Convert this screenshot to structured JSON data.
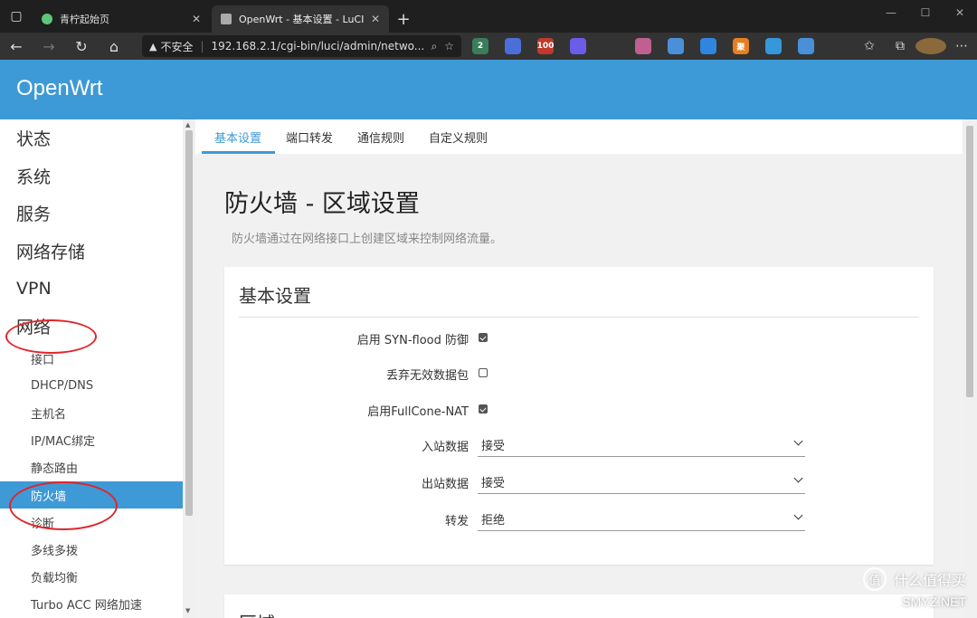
{
  "browser": {
    "tabs": [
      {
        "title": "青柠起始页",
        "active": false,
        "favicon_color": "#5cc77a"
      },
      {
        "title": "OpenWrt - 基本设置 - LuCI",
        "active": true,
        "favicon_color": "#aaaaaa"
      }
    ],
    "security_label": "不安全",
    "url": "192.168.2.1/cgi-bin/luci/admin/netwo...",
    "extensions": [
      {
        "name": "ext-a",
        "badge": "2",
        "color": "#3a7d5a"
      },
      {
        "name": "ext-b",
        "badge": "",
        "color": "#4b6fd8"
      },
      {
        "name": "ext-zh",
        "badge": "100",
        "color": "#c0392b"
      },
      {
        "name": "ext-d",
        "badge": "",
        "color": "#6c5ce7"
      },
      {
        "name": "ext-e",
        "badge": "",
        "color": "#333333"
      },
      {
        "name": "ext-cat",
        "badge": "",
        "color": "#c06090"
      },
      {
        "name": "ext-g",
        "badge": "",
        "color": "#4a90d9"
      },
      {
        "name": "ext-h",
        "badge": "",
        "color": "#2e86de"
      },
      {
        "name": "ext-ju",
        "badge": "聚",
        "color": "#e67e22"
      },
      {
        "name": "ext-j",
        "badge": "",
        "color": "#3498db"
      },
      {
        "name": "ext-k",
        "badge": "",
        "color": "#4a90d9"
      }
    ]
  },
  "app": {
    "brand": "OpenWrt",
    "accent": "#3e9ad6"
  },
  "sidebar": {
    "main_items": [
      "状态",
      "系统",
      "服务",
      "网络存储",
      "VPN",
      "网络"
    ],
    "sub_items": [
      "接口",
      "DHCP/DNS",
      "主机名",
      "IP/MAC绑定",
      "静态路由",
      "防火墙",
      "诊断",
      "多线多拨",
      "负载均衡",
      "Turbo ACC 网络加速"
    ],
    "active_sub": "防火墙"
  },
  "content_tabs": [
    "基本设置",
    "端口转发",
    "通信规则",
    "自定义规则"
  ],
  "page": {
    "title": "防火墙 - 区域设置",
    "description": "防火墙通过在网络接口上创建区域来控制网络流量。"
  },
  "section": {
    "title": "基本设置",
    "checkboxes": [
      {
        "label": "启用 SYN-flood 防御",
        "checked": true
      },
      {
        "label": "丢弃无效数据包",
        "checked": false
      },
      {
        "label": "启用FullCone-NAT",
        "checked": true
      }
    ],
    "selects": [
      {
        "label": "入站数据",
        "value": "接受"
      },
      {
        "label": "出站数据",
        "value": "接受"
      },
      {
        "label": "转发",
        "value": "拒绝"
      }
    ]
  },
  "section2": {
    "title": "区域"
  },
  "watermark": {
    "text": "什么值得买",
    "logo_char": "值",
    "site": "SMYZ.NET"
  }
}
